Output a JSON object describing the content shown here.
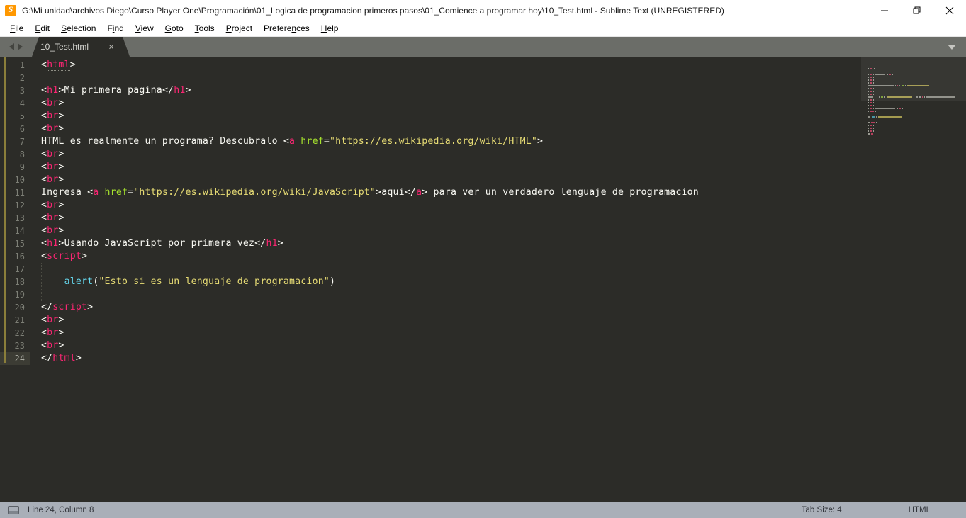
{
  "window": {
    "title": "G:\\Mi unidad\\archivos Diego\\Curso Player One\\Programación\\01_Logica de programacion primeros pasos\\01_Comience a programar hoy\\10_Test.html - Sublime Text (UNREGISTERED)",
    "app_icon": "sublime-text-icon",
    "controls": {
      "minimize": "minimize-icon",
      "maximize": "restore-icon",
      "close": "close-icon"
    }
  },
  "menubar": {
    "items": [
      {
        "label": "File",
        "mnemonic_index": 0
      },
      {
        "label": "Edit",
        "mnemonic_index": 0
      },
      {
        "label": "Selection",
        "mnemonic_index": 0
      },
      {
        "label": "Find",
        "mnemonic_index": 1
      },
      {
        "label": "View",
        "mnemonic_index": 0
      },
      {
        "label": "Goto",
        "mnemonic_index": 0
      },
      {
        "label": "Tools",
        "mnemonic_index": 0
      },
      {
        "label": "Project",
        "mnemonic_index": 0
      },
      {
        "label": "Preferences",
        "mnemonic_index": 7
      },
      {
        "label": "Help",
        "mnemonic_index": 0
      }
    ]
  },
  "tabbar": {
    "prev_arrow": "chevron-left-icon",
    "next_arrow": "chevron-right-icon",
    "tabs": [
      {
        "label": "10_Test.html",
        "active": true,
        "close": "×"
      }
    ],
    "overflow_menu": "chevron-down-icon"
  },
  "editor": {
    "first_line": 1,
    "cursor_line": 24,
    "lines": [
      {
        "n": 1,
        "tokens": [
          {
            "t": "tagpunct",
            "v": "<"
          },
          {
            "t": "tagname spell",
            "v": "html"
          },
          {
            "t": "tagpunct",
            "v": ">"
          }
        ]
      },
      {
        "n": 2,
        "tokens": []
      },
      {
        "n": 3,
        "tokens": [
          {
            "t": "tagpunct",
            "v": "<"
          },
          {
            "t": "tagname",
            "v": "h1"
          },
          {
            "t": "tagpunct",
            "v": ">"
          },
          {
            "t": "plain",
            "v": "Mi primera pagina"
          },
          {
            "t": "tagpunct",
            "v": "</"
          },
          {
            "t": "tagname",
            "v": "h1"
          },
          {
            "t": "tagpunct",
            "v": ">"
          }
        ]
      },
      {
        "n": 4,
        "tokens": [
          {
            "t": "tagpunct",
            "v": "<"
          },
          {
            "t": "tagname",
            "v": "br"
          },
          {
            "t": "tagpunct",
            "v": ">"
          }
        ]
      },
      {
        "n": 5,
        "tokens": [
          {
            "t": "tagpunct",
            "v": "<"
          },
          {
            "t": "tagname",
            "v": "br"
          },
          {
            "t": "tagpunct",
            "v": ">"
          }
        ]
      },
      {
        "n": 6,
        "tokens": [
          {
            "t": "tagpunct",
            "v": "<"
          },
          {
            "t": "tagname",
            "v": "br"
          },
          {
            "t": "tagpunct",
            "v": ">"
          }
        ]
      },
      {
        "n": 7,
        "tokens": [
          {
            "t": "plain",
            "v": "HTML es realmente un programa? Descubralo "
          },
          {
            "t": "tagpunct",
            "v": "<"
          },
          {
            "t": "tagname",
            "v": "a"
          },
          {
            "t": "plain",
            "v": " "
          },
          {
            "t": "attr",
            "v": "href"
          },
          {
            "t": "tagpunct",
            "v": "="
          },
          {
            "t": "str",
            "v": "\"https://es.wikipedia.org/wiki/HTML\""
          },
          {
            "t": "tagpunct",
            "v": ">"
          }
        ]
      },
      {
        "n": 8,
        "tokens": [
          {
            "t": "tagpunct",
            "v": "<"
          },
          {
            "t": "tagname",
            "v": "br"
          },
          {
            "t": "tagpunct",
            "v": ">"
          }
        ]
      },
      {
        "n": 9,
        "tokens": [
          {
            "t": "tagpunct",
            "v": "<"
          },
          {
            "t": "tagname",
            "v": "br"
          },
          {
            "t": "tagpunct",
            "v": ">"
          }
        ]
      },
      {
        "n": 10,
        "tokens": [
          {
            "t": "tagpunct",
            "v": "<"
          },
          {
            "t": "tagname",
            "v": "br"
          },
          {
            "t": "tagpunct",
            "v": ">"
          }
        ]
      },
      {
        "n": 11,
        "tokens": [
          {
            "t": "plain",
            "v": "Ingresa "
          },
          {
            "t": "tagpunct",
            "v": "<"
          },
          {
            "t": "tagname",
            "v": "a"
          },
          {
            "t": "plain",
            "v": " "
          },
          {
            "t": "attr",
            "v": "href"
          },
          {
            "t": "tagpunct",
            "v": "="
          },
          {
            "t": "str",
            "v": "\"https://es.wikipedia.org/wiki/JavaScript\""
          },
          {
            "t": "tagpunct",
            "v": ">"
          },
          {
            "t": "plain",
            "v": "aqui"
          },
          {
            "t": "tagpunct",
            "v": "</"
          },
          {
            "t": "tagname",
            "v": "a"
          },
          {
            "t": "tagpunct",
            "v": ">"
          },
          {
            "t": "plain",
            "v": " para ver un verdadero lenguaje de programacion"
          }
        ]
      },
      {
        "n": 12,
        "tokens": [
          {
            "t": "tagpunct",
            "v": "<"
          },
          {
            "t": "tagname",
            "v": "br"
          },
          {
            "t": "tagpunct",
            "v": ">"
          }
        ]
      },
      {
        "n": 13,
        "tokens": [
          {
            "t": "tagpunct",
            "v": "<"
          },
          {
            "t": "tagname",
            "v": "br"
          },
          {
            "t": "tagpunct",
            "v": ">"
          }
        ]
      },
      {
        "n": 14,
        "tokens": [
          {
            "t": "tagpunct",
            "v": "<"
          },
          {
            "t": "tagname",
            "v": "br"
          },
          {
            "t": "tagpunct",
            "v": ">"
          }
        ]
      },
      {
        "n": 15,
        "tokens": [
          {
            "t": "tagpunct",
            "v": "<"
          },
          {
            "t": "tagname",
            "v": "h1"
          },
          {
            "t": "tagpunct",
            "v": ">"
          },
          {
            "t": "plain",
            "v": "Usando JavaScript por primera vez"
          },
          {
            "t": "tagpunct",
            "v": "</"
          },
          {
            "t": "tagname",
            "v": "h1"
          },
          {
            "t": "tagpunct",
            "v": ">"
          }
        ]
      },
      {
        "n": 16,
        "tokens": [
          {
            "t": "tagpunct",
            "v": "<"
          },
          {
            "t": "tagname",
            "v": "script"
          },
          {
            "t": "tagpunct",
            "v": ">"
          }
        ]
      },
      {
        "n": 17,
        "tokens": []
      },
      {
        "n": 18,
        "tokens": [
          {
            "t": "plain",
            "v": "    "
          },
          {
            "t": "fn",
            "v": "alert"
          },
          {
            "t": "plain",
            "v": "("
          },
          {
            "t": "str",
            "v": "\"Esto si es un lenguaje de programacion\""
          },
          {
            "t": "plain",
            "v": ")"
          }
        ]
      },
      {
        "n": 19,
        "tokens": []
      },
      {
        "n": 20,
        "tokens": [
          {
            "t": "tagpunct",
            "v": "</"
          },
          {
            "t": "tagname",
            "v": "script"
          },
          {
            "t": "tagpunct",
            "v": ">"
          }
        ]
      },
      {
        "n": 21,
        "tokens": [
          {
            "t": "tagpunct",
            "v": "<"
          },
          {
            "t": "tagname",
            "v": "br"
          },
          {
            "t": "tagpunct",
            "v": ">"
          }
        ]
      },
      {
        "n": 22,
        "tokens": [
          {
            "t": "tagpunct",
            "v": "<"
          },
          {
            "t": "tagname",
            "v": "br"
          },
          {
            "t": "tagpunct",
            "v": ">"
          }
        ]
      },
      {
        "n": 23,
        "tokens": [
          {
            "t": "tagpunct",
            "v": "<"
          },
          {
            "t": "tagname",
            "v": "br"
          },
          {
            "t": "tagpunct",
            "v": ">"
          }
        ]
      },
      {
        "n": 24,
        "tokens": [
          {
            "t": "tagpunct",
            "v": "</"
          },
          {
            "t": "tagname spell",
            "v": "html"
          },
          {
            "t": "tagpunct",
            "v": ">"
          }
        ],
        "caret": true
      }
    ],
    "theme_colors": {
      "background": "#2c2c28",
      "gutter_text": "#7d7f76",
      "current_line_gutter": "#3c3c34",
      "foreground": "#f8f8f2",
      "tag_name": "#f92672",
      "attribute": "#a6e22e",
      "string": "#e6db74",
      "function": "#66d9ef",
      "modified_marker": "#8a7e3a"
    }
  },
  "minimap": {
    "name": "code-minimap",
    "viewport_visible": true
  },
  "statusbar": {
    "encoding_icon": "panel-icon",
    "position": "Line 24, Column 8",
    "tab_size": "Tab Size: 4",
    "syntax": "HTML"
  }
}
